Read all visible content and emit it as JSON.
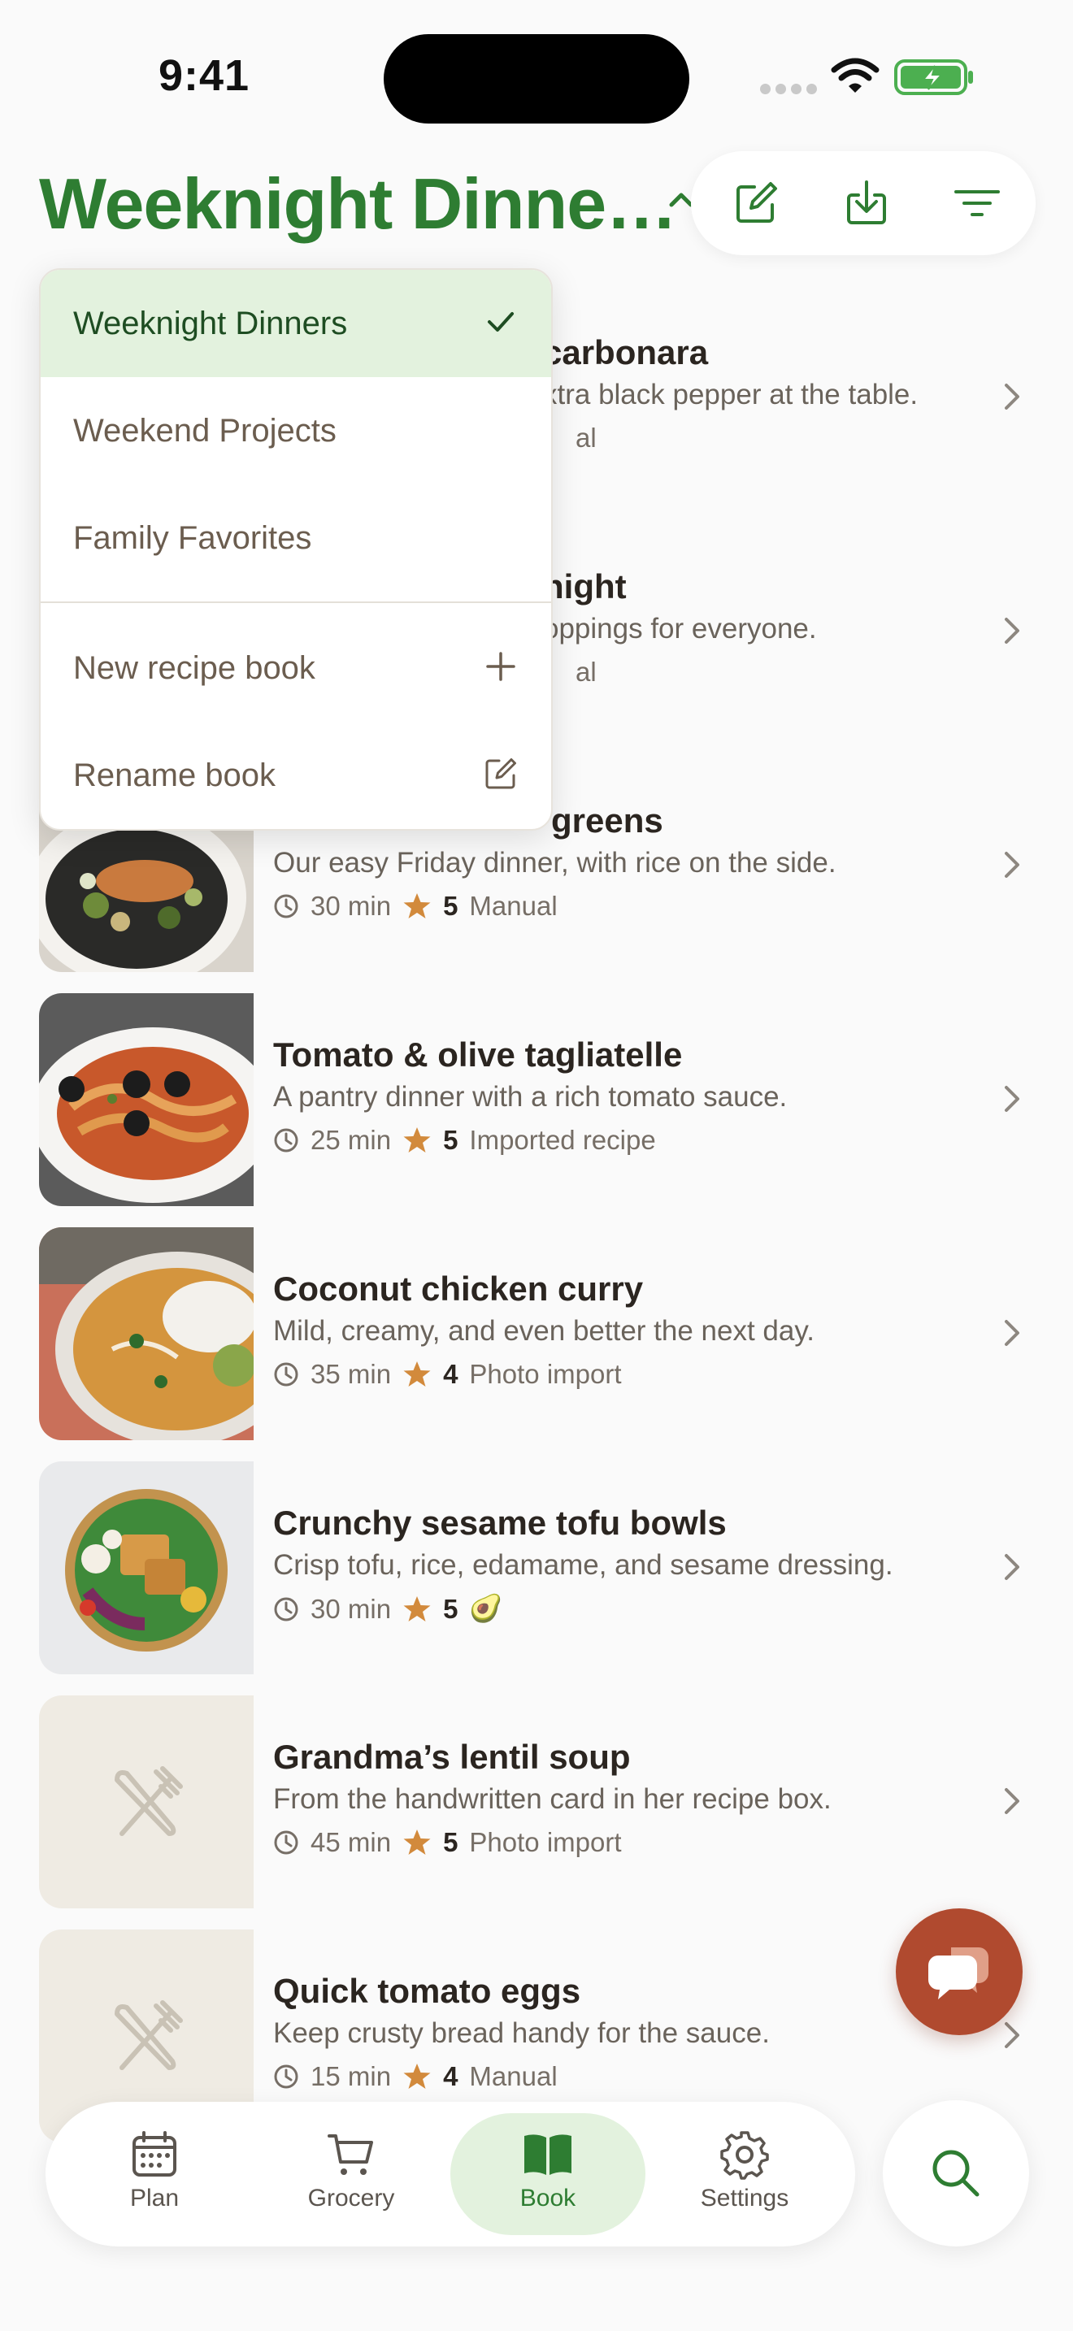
{
  "status_bar": {
    "time": "9:41"
  },
  "header": {
    "title": "Weeknight Dinne…",
    "actions": [
      "edit-icon",
      "download-icon",
      "filter-icon"
    ]
  },
  "book_menu": {
    "books": [
      {
        "label": "Weeknight Dinners",
        "selected": true
      },
      {
        "label": "Weekend Projects",
        "selected": false
      },
      {
        "label": "Family Favorites",
        "selected": false
      }
    ],
    "actions": [
      {
        "label": "New recipe book",
        "icon": "plus-icon"
      },
      {
        "label": "Rename book",
        "icon": "edit-icon"
      }
    ]
  },
  "recipes": [
    {
      "title": "carbonara",
      "description": "xtra black pepper at the table.",
      "meta_source": "al"
    },
    {
      "title": "night",
      "description": "oppings for everyone.",
      "meta_source": "al"
    },
    {
      "title": "greens",
      "description": "Our easy Friday dinner, with rice on the side.",
      "time": "30 min",
      "rating": "5",
      "source": "Manual"
    },
    {
      "title": "Tomato & olive tagliatelle",
      "description": "A pantry dinner with a rich tomato sauce.",
      "time": "25 min",
      "rating": "5",
      "source": "Imported recipe"
    },
    {
      "title": "Coconut chicken curry",
      "description": "Mild, creamy, and even better the next day.",
      "time": "35 min",
      "rating": "4",
      "source": "Photo import"
    },
    {
      "title": "Crunchy sesame tofu bowls",
      "description": "Crisp tofu, rice, edamame, and sesame dressing.",
      "time": "30 min",
      "rating": "5",
      "source": "🥑"
    },
    {
      "title": "Grandma’s lentil soup",
      "description": "From the handwritten card in her recipe box.",
      "time": "45 min",
      "rating": "5",
      "source": "Photo import"
    },
    {
      "title": "Quick tomato eggs",
      "description": "Keep crusty bread handy for the sauce.",
      "time": "15 min",
      "rating": "4",
      "source": "Manual"
    }
  ],
  "tabs": [
    {
      "label": "Plan",
      "icon": "calendar-icon"
    },
    {
      "label": "Grocery",
      "icon": "cart-icon"
    },
    {
      "label": "Book",
      "icon": "book-icon",
      "active": true
    },
    {
      "label": "Settings",
      "icon": "gear-icon"
    }
  ],
  "colors": {
    "accent": "#2e7d32",
    "active_tab_bg": "#e3f2de",
    "fab": "#b04a2f",
    "star": "#d28a3c"
  }
}
